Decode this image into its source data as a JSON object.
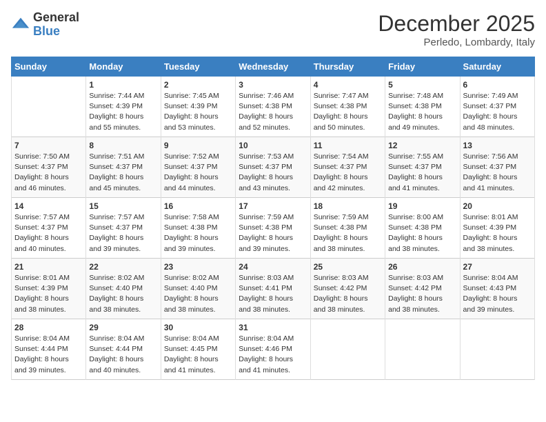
{
  "header": {
    "logo_general": "General",
    "logo_blue": "Blue",
    "month": "December 2025",
    "location": "Perledo, Lombardy, Italy"
  },
  "days_of_week": [
    "Sunday",
    "Monday",
    "Tuesday",
    "Wednesday",
    "Thursday",
    "Friday",
    "Saturday"
  ],
  "weeks": [
    [
      {
        "day": "",
        "info": ""
      },
      {
        "day": "1",
        "info": "Sunrise: 7:44 AM\nSunset: 4:39 PM\nDaylight: 8 hours\nand 55 minutes."
      },
      {
        "day": "2",
        "info": "Sunrise: 7:45 AM\nSunset: 4:39 PM\nDaylight: 8 hours\nand 53 minutes."
      },
      {
        "day": "3",
        "info": "Sunrise: 7:46 AM\nSunset: 4:38 PM\nDaylight: 8 hours\nand 52 minutes."
      },
      {
        "day": "4",
        "info": "Sunrise: 7:47 AM\nSunset: 4:38 PM\nDaylight: 8 hours\nand 50 minutes."
      },
      {
        "day": "5",
        "info": "Sunrise: 7:48 AM\nSunset: 4:38 PM\nDaylight: 8 hours\nand 49 minutes."
      },
      {
        "day": "6",
        "info": "Sunrise: 7:49 AM\nSunset: 4:37 PM\nDaylight: 8 hours\nand 48 minutes."
      }
    ],
    [
      {
        "day": "7",
        "info": "Sunrise: 7:50 AM\nSunset: 4:37 PM\nDaylight: 8 hours\nand 46 minutes."
      },
      {
        "day": "8",
        "info": "Sunrise: 7:51 AM\nSunset: 4:37 PM\nDaylight: 8 hours\nand 45 minutes."
      },
      {
        "day": "9",
        "info": "Sunrise: 7:52 AM\nSunset: 4:37 PM\nDaylight: 8 hours\nand 44 minutes."
      },
      {
        "day": "10",
        "info": "Sunrise: 7:53 AM\nSunset: 4:37 PM\nDaylight: 8 hours\nand 43 minutes."
      },
      {
        "day": "11",
        "info": "Sunrise: 7:54 AM\nSunset: 4:37 PM\nDaylight: 8 hours\nand 42 minutes."
      },
      {
        "day": "12",
        "info": "Sunrise: 7:55 AM\nSunset: 4:37 PM\nDaylight: 8 hours\nand 41 minutes."
      },
      {
        "day": "13",
        "info": "Sunrise: 7:56 AM\nSunset: 4:37 PM\nDaylight: 8 hours\nand 41 minutes."
      }
    ],
    [
      {
        "day": "14",
        "info": "Sunrise: 7:57 AM\nSunset: 4:37 PM\nDaylight: 8 hours\nand 40 minutes."
      },
      {
        "day": "15",
        "info": "Sunrise: 7:57 AM\nSunset: 4:37 PM\nDaylight: 8 hours\nand 39 minutes."
      },
      {
        "day": "16",
        "info": "Sunrise: 7:58 AM\nSunset: 4:38 PM\nDaylight: 8 hours\nand 39 minutes."
      },
      {
        "day": "17",
        "info": "Sunrise: 7:59 AM\nSunset: 4:38 PM\nDaylight: 8 hours\nand 39 minutes."
      },
      {
        "day": "18",
        "info": "Sunrise: 7:59 AM\nSunset: 4:38 PM\nDaylight: 8 hours\nand 38 minutes."
      },
      {
        "day": "19",
        "info": "Sunrise: 8:00 AM\nSunset: 4:38 PM\nDaylight: 8 hours\nand 38 minutes."
      },
      {
        "day": "20",
        "info": "Sunrise: 8:01 AM\nSunset: 4:39 PM\nDaylight: 8 hours\nand 38 minutes."
      }
    ],
    [
      {
        "day": "21",
        "info": "Sunrise: 8:01 AM\nSunset: 4:39 PM\nDaylight: 8 hours\nand 38 minutes."
      },
      {
        "day": "22",
        "info": "Sunrise: 8:02 AM\nSunset: 4:40 PM\nDaylight: 8 hours\nand 38 minutes."
      },
      {
        "day": "23",
        "info": "Sunrise: 8:02 AM\nSunset: 4:40 PM\nDaylight: 8 hours\nand 38 minutes."
      },
      {
        "day": "24",
        "info": "Sunrise: 8:03 AM\nSunset: 4:41 PM\nDaylight: 8 hours\nand 38 minutes."
      },
      {
        "day": "25",
        "info": "Sunrise: 8:03 AM\nSunset: 4:42 PM\nDaylight: 8 hours\nand 38 minutes."
      },
      {
        "day": "26",
        "info": "Sunrise: 8:03 AM\nSunset: 4:42 PM\nDaylight: 8 hours\nand 38 minutes."
      },
      {
        "day": "27",
        "info": "Sunrise: 8:04 AM\nSunset: 4:43 PM\nDaylight: 8 hours\nand 39 minutes."
      }
    ],
    [
      {
        "day": "28",
        "info": "Sunrise: 8:04 AM\nSunset: 4:44 PM\nDaylight: 8 hours\nand 39 minutes."
      },
      {
        "day": "29",
        "info": "Sunrise: 8:04 AM\nSunset: 4:44 PM\nDaylight: 8 hours\nand 40 minutes."
      },
      {
        "day": "30",
        "info": "Sunrise: 8:04 AM\nSunset: 4:45 PM\nDaylight: 8 hours\nand 41 minutes."
      },
      {
        "day": "31",
        "info": "Sunrise: 8:04 AM\nSunset: 4:46 PM\nDaylight: 8 hours\nand 41 minutes."
      },
      {
        "day": "",
        "info": ""
      },
      {
        "day": "",
        "info": ""
      },
      {
        "day": "",
        "info": ""
      }
    ]
  ]
}
